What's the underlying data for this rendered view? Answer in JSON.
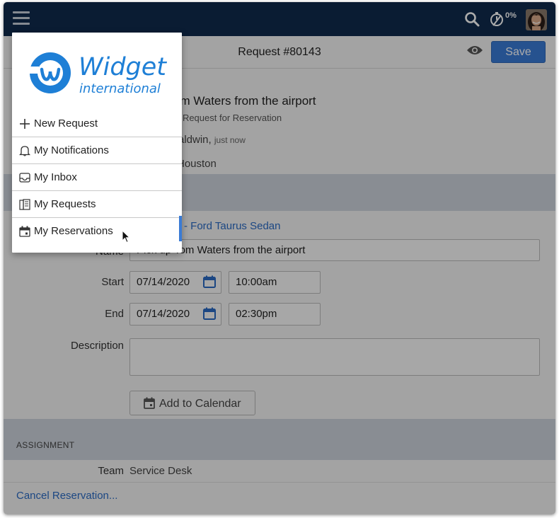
{
  "topbar": {
    "menu_icon": "hamburger-menu-icon",
    "search_icon": "search-icon",
    "timer_icon": "stopwatch-icon",
    "timer_percent": "0%",
    "avatar": "user-avatar"
  },
  "header": {
    "title": "Request #80143",
    "preview_icon": "eye-icon",
    "save_label": "Save"
  },
  "summary": {
    "title": "om Waters from the airport",
    "subtitle": "- Request for Reservation",
    "user": "aldwin,",
    "time": "just now",
    "location": "Houston"
  },
  "reservation": {
    "resource": "- Ford Taurus Sedan",
    "name_label": "Name",
    "name_value": "Pick up Tom Waters from the airport",
    "start_label": "Start",
    "start_date": "07/14/2020",
    "start_time": "10:00am",
    "end_label": "End",
    "end_date": "07/14/2020",
    "end_time": "02:30pm",
    "description_label": "Description",
    "description_value": "",
    "add_calendar": "Add to Calendar"
  },
  "assignment": {
    "heading": "ASSIGNMENT",
    "team_label": "Team",
    "team_value": "Service Desk"
  },
  "footer": {
    "cancel": "Cancel Reservation..."
  },
  "menu": {
    "logo_line1": "Widget",
    "logo_line2": "international",
    "items": [
      {
        "label": "New Request",
        "icon": "plus-icon"
      },
      {
        "label": "My Notifications",
        "icon": "bell-icon"
      },
      {
        "label": "My Inbox",
        "icon": "inbox-icon"
      },
      {
        "label": "My Requests",
        "icon": "requests-icon"
      },
      {
        "label": "My Reservations",
        "icon": "calendar-icon"
      }
    ]
  },
  "colors": {
    "topbar": "#102a4c",
    "accent": "#3a7bd5",
    "link": "#2a6bc4",
    "logo": "#1e7fd6"
  }
}
